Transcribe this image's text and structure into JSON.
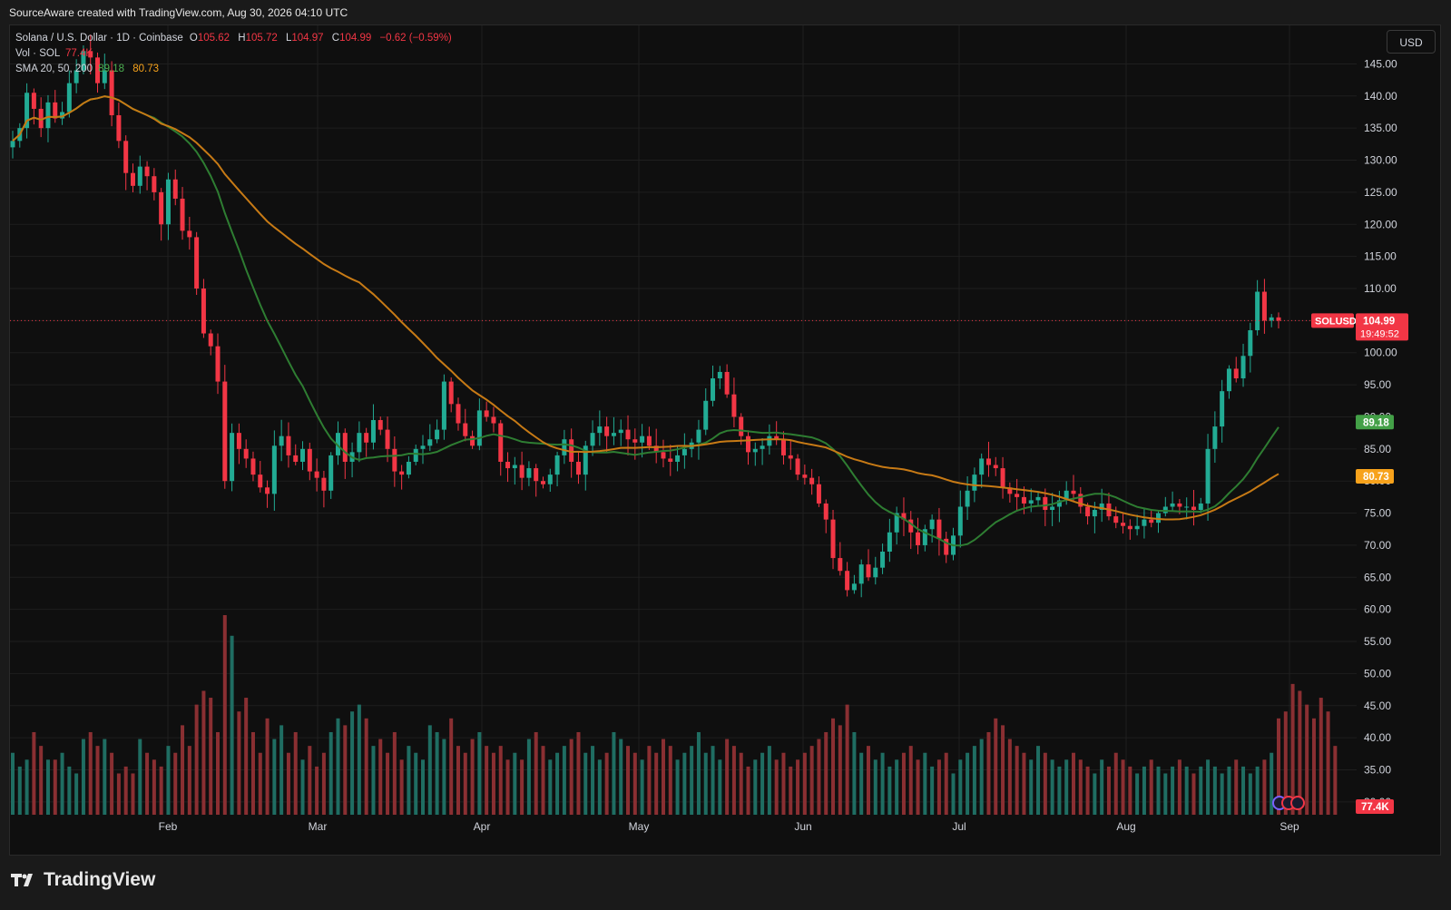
{
  "caption": "SourceAware created with TradingView.com, Aug 30, 2026 04:10 UTC",
  "brand": {
    "name": "TradingView",
    "icon": "tradingview-logo-icon"
  },
  "currency_button": "USD",
  "legend": {
    "symbol": "Solana / U.S. Dollar · 1D · Coinbase",
    "o_label": "O",
    "o": "105.62",
    "h_label": "H",
    "h": "105.72",
    "l_label": "L",
    "l": "104.97",
    "c_label": "C",
    "c": "104.99",
    "change": "−0.62 (−0.59%)",
    "vol_label": "Vol · SOL",
    "vol": "77.4K",
    "sma_label": "SMA 20, 50, 200",
    "sma1": "89.18",
    "sma2": "80.73"
  },
  "colors": {
    "up": "#22ab94",
    "down": "#f23645",
    "vol_up": "#1f6d62",
    "vol_down": "#8a2f32",
    "sma_fast": "#4caf50",
    "sma_slow": "#f7a21b",
    "price_line": "#f23645"
  },
  "chart_data": {
    "type": "candlestick",
    "symbol": "SOLUSD",
    "x_ticks": [
      "Feb",
      "Mar",
      "Apr",
      "May",
      "Jun",
      "Jul",
      "Aug",
      "Sep"
    ],
    "y_ticks": [
      "30.00",
      "35.00",
      "40.00",
      "45.00",
      "50.00",
      "55.00",
      "60.00",
      "65.00",
      "70.00",
      "75.00",
      "80.00",
      "85.00",
      "90.00",
      "95.00",
      "100.00",
      "105.00",
      "110.00",
      "115.00",
      "120.00",
      "125.00",
      "130.00",
      "135.00",
      "140.00",
      "145.00"
    ],
    "ylim": [
      28,
      151
    ],
    "last_price_label": "104.99",
    "countdown": "19:49:52",
    "sma_fast_label": "89.18",
    "sma_slow_label": "80.73",
    "volume_label": "77.4K",
    "closes": [
      133.0,
      135.0,
      140.5,
      138.0,
      135.0,
      139.0,
      136.5,
      137.5,
      142.0,
      144.0,
      147.0,
      146.0,
      142.0,
      144.0,
      137.0,
      133.0,
      128.0,
      126.0,
      129.0,
      127.5,
      125.0,
      120.0,
      127.0,
      124.0,
      119.0,
      118.0,
      110.0,
      103.0,
      101.0,
      95.5,
      80.0,
      87.5,
      85.0,
      83.5,
      81.0,
      79.0,
      78.0,
      85.5,
      87.0,
      84.0,
      83.0,
      85.0,
      81.5,
      80.5,
      78.5,
      84.0,
      87.5,
      83.0,
      84.5,
      87.5,
      86.0,
      89.5,
      88.0,
      85.0,
      81.5,
      81.0,
      83.0,
      85.0,
      85.5,
      86.5,
      88.0,
      95.5,
      92.0,
      89.0,
      87.0,
      85.5,
      91.0,
      90.0,
      89.0,
      83.0,
      82.0,
      82.5,
      80.5,
      82.0,
      80.0,
      79.5,
      81.0,
      84.0,
      86.5,
      83.0,
      81.0,
      85.5,
      87.5,
      88.5,
      87.0,
      87.5,
      88.0,
      86.5,
      86.0,
      87.0,
      85.5,
      84.5,
      83.5,
      83.0,
      84.0,
      85.0,
      86.0,
      88.0,
      92.5,
      96.0,
      97.0,
      93.5,
      90.0,
      87.0,
      84.5,
      85.0,
      85.5,
      87.0,
      86.5,
      84.0,
      83.5,
      81.0,
      80.5,
      79.5,
      76.5,
      74.0,
      68.0,
      66.0,
      63.0,
      64.0,
      67.0,
      65.0,
      66.5,
      69.0,
      72.0,
      75.0,
      74.0,
      72.0,
      70.0,
      72.5,
      74.0,
      71.0,
      68.5,
      71.5,
      76.0,
      78.5,
      81.0,
      83.5,
      82.5,
      82.0,
      79.0,
      78.0,
      77.5,
      76.5,
      77.0,
      77.5,
      75.5,
      76.0,
      77.0,
      78.5,
      78.0,
      76.0,
      74.5,
      75.5,
      76.5,
      74.5,
      73.5,
      73.0,
      72.5,
      73.0,
      74.0,
      73.5,
      75.0,
      76.0,
      76.5,
      76.0,
      76.0,
      75.5,
      76.5,
      85.0,
      88.5,
      94.0,
      97.5,
      96.0,
      99.5,
      103.5,
      109.5,
      105.0,
      105.5,
      104.99
    ],
    "volumes": [
      9,
      7,
      8,
      12,
      10,
      8,
      8,
      9,
      7,
      6,
      11,
      12,
      10,
      11,
      9,
      6,
      7,
      6,
      11,
      9,
      8,
      7,
      10,
      9,
      13,
      10,
      16,
      18,
      17,
      12,
      29,
      26,
      15,
      17,
      12,
      9,
      14,
      11,
      13,
      9,
      12,
      8,
      10,
      7,
      9,
      12,
      14,
      13,
      15,
      16,
      14,
      10,
      11,
      9,
      12,
      8,
      10,
      9,
      8,
      13,
      12,
      11,
      14,
      10,
      9,
      11,
      12,
      10,
      9,
      10,
      8,
      9,
      8,
      11,
      12,
      10,
      8,
      9,
      10,
      11,
      12,
      9,
      10,
      8,
      9,
      12,
      11,
      10,
      9,
      8,
      10,
      9,
      11,
      10,
      8,
      9,
      10,
      12,
      9,
      10,
      8,
      11,
      10,
      9,
      7,
      8,
      9,
      10,
      8,
      9,
      7,
      8,
      9,
      10,
      11,
      12,
      14,
      13,
      16,
      12,
      9,
      10,
      8,
      9,
      7,
      8,
      9,
      10,
      8,
      9,
      7,
      8,
      9,
      6,
      8,
      9,
      10,
      11,
      12,
      14,
      13,
      11,
      10,
      9,
      8,
      10,
      9,
      8,
      7,
      8,
      9,
      8,
      7,
      6,
      8,
      7,
      9,
      8,
      7,
      6,
      7,
      8,
      7,
      6,
      7,
      8,
      7,
      6,
      7,
      8,
      7,
      6,
      7,
      8,
      7,
      6,
      7,
      8,
      9,
      14,
      15,
      19,
      18,
      16,
      14,
      17,
      15,
      10
    ]
  }
}
